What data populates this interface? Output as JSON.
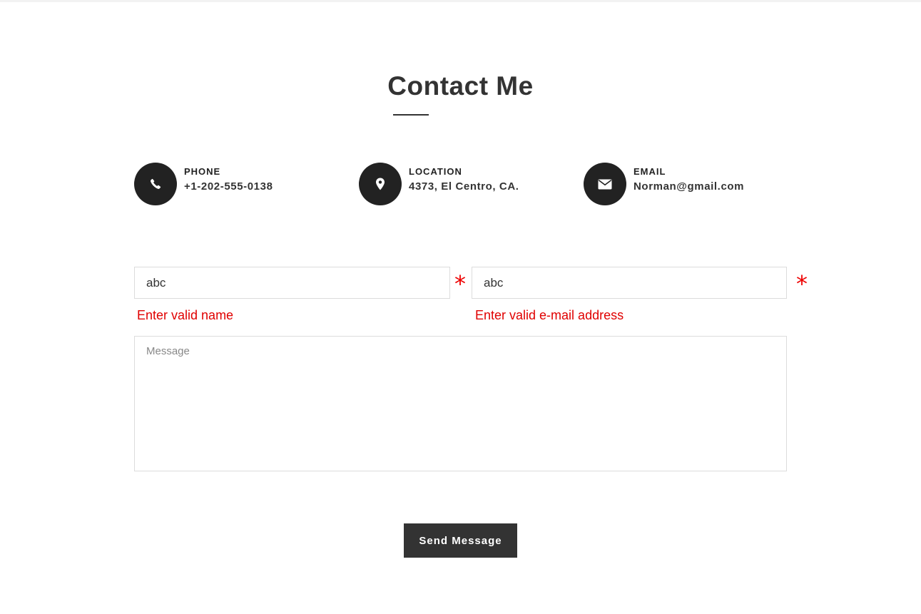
{
  "section": {
    "title": "Contact Me"
  },
  "contact_info": [
    {
      "icon": "phone-icon",
      "label": "PHONE",
      "value": "+1-202-555-0138"
    },
    {
      "icon": "location-pin-icon",
      "label": "LOCATION",
      "value": "4373, El Centro, CA."
    },
    {
      "icon": "envelope-icon",
      "label": "EMAIL",
      "value": "Norman@gmail.com"
    }
  ],
  "form": {
    "name": {
      "value": "abc",
      "placeholder": "",
      "required_mark": "*",
      "error": "Enter valid name"
    },
    "email": {
      "value": "abc",
      "placeholder": "",
      "required_mark": "*",
      "error": "Enter valid e-mail address"
    },
    "message": {
      "value": "",
      "placeholder": "Message"
    },
    "submit_label": "Send Message"
  },
  "colors": {
    "dark": "#333333",
    "icon_circle": "#222222",
    "error": "#e00000",
    "border": "#dcdcdc"
  }
}
